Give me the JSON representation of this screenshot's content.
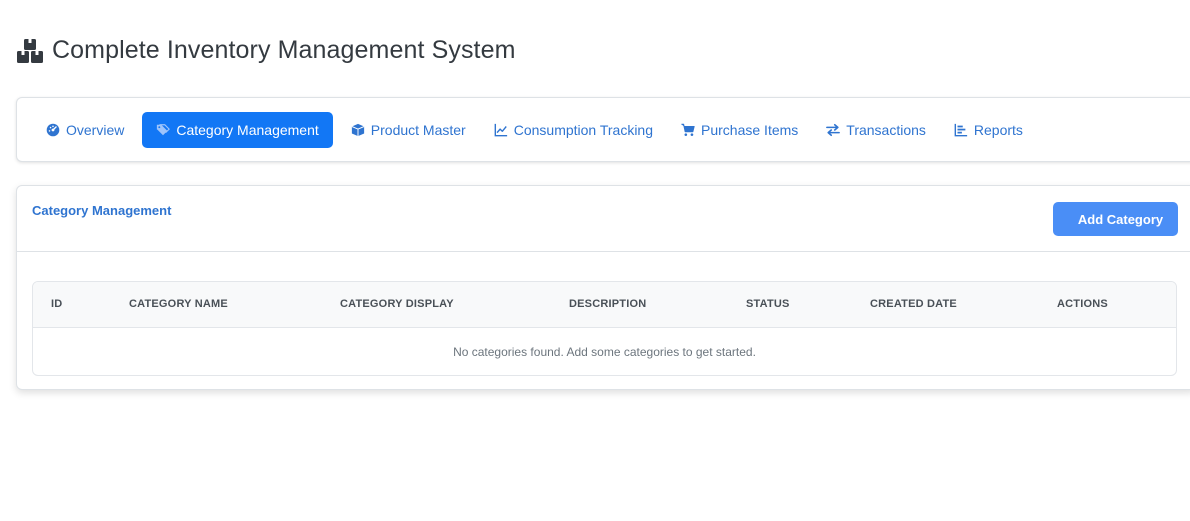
{
  "app": {
    "title": "Complete Inventory Management System",
    "icon": "boxes-icon"
  },
  "nav": {
    "items": [
      {
        "label": "Overview",
        "icon": "gauge-icon",
        "active": false
      },
      {
        "label": "Category Management",
        "icon": "tags-icon",
        "active": true
      },
      {
        "label": "Product Master",
        "icon": "box-icon",
        "active": false
      },
      {
        "label": "Consumption Tracking",
        "icon": "line-chart-icon",
        "active": false
      },
      {
        "label": "Purchase Items",
        "icon": "cart-icon",
        "active": false
      },
      {
        "label": "Transactions",
        "icon": "exchange-icon",
        "active": false
      },
      {
        "label": "Reports",
        "icon": "bar-list-icon",
        "active": false
      }
    ]
  },
  "panel": {
    "title": "Category Management",
    "add_button": "Add Category"
  },
  "table": {
    "columns": [
      "ID",
      "CATEGORY NAME",
      "CATEGORY DISPLAY",
      "DESCRIPTION",
      "STATUS",
      "CREATED DATE",
      "ACTIONS"
    ],
    "empty_message": "No categories found. Add some categories to get started."
  },
  "colors": {
    "accent": "#1277f5",
    "link": "#2f74d0",
    "button": "#4a8ef6"
  }
}
